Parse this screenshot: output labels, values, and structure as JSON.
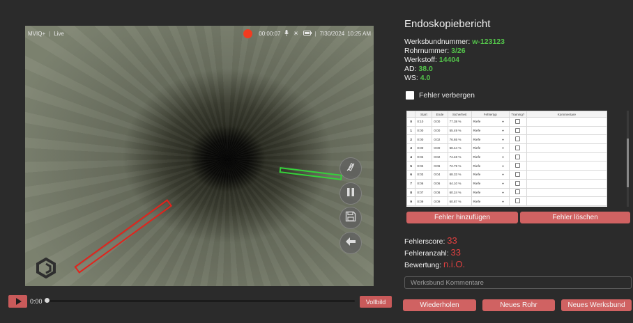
{
  "video": {
    "brand": "MVIQ+",
    "mode": "Live",
    "rec_time": "00:00:07",
    "date": "7/30/2024",
    "time": "10:25 AM",
    "side_buttons": [
      "light-off-icon",
      "pause-icon",
      "save-icon",
      "back-arrow-icon"
    ],
    "defect_colors": {
      "green": "#35d13a",
      "red": "#e2231c"
    }
  },
  "playback": {
    "time": "0:00",
    "fullscreen_label": "Vollbild",
    "play_color": "#c95a5a"
  },
  "report": {
    "title": "Endoskopiebericht",
    "fields": [
      {
        "label": "Werksbundnummer: ",
        "value": "w-123123"
      },
      {
        "label": "Rohrnummer: ",
        "value": "3/26"
      },
      {
        "label": "Werkstoff: ",
        "value": "14404"
      },
      {
        "label": "AD: ",
        "value": "38.0"
      },
      {
        "label": "WS: ",
        "value": "4.0"
      }
    ],
    "hide_errors_label": "Fehler verbergen",
    "table": {
      "columns": [
        "",
        "Start",
        "Ende",
        "Sicherheit",
        "Fehlertyp",
        "Training?",
        "Kommentare"
      ],
      "rows": [
        {
          "idx": "0",
          "start": "0:10",
          "end": "0:00",
          "conf": "77.38 %",
          "type": "Riefe"
        },
        {
          "idx": "1",
          "start": "0:00",
          "end": "0:00",
          "conf": "55.49 %",
          "type": "Riefe"
        },
        {
          "idx": "2",
          "start": "0:00",
          "end": "0:02",
          "conf": "76.65 %",
          "type": "Riefe"
        },
        {
          "idx": "3",
          "start": "0:00",
          "end": "0:00",
          "conf": "68.44 %",
          "type": "Riefe"
        },
        {
          "idx": "4",
          "start": "0:02",
          "end": "0:02",
          "conf": "74.48 %",
          "type": "Riefe"
        },
        {
          "idx": "5",
          "start": "0:02",
          "end": "0:06",
          "conf": "72.79 %",
          "type": "Riefe"
        },
        {
          "idx": "6",
          "start": "0:03",
          "end": "0:04",
          "conf": "68.33 %",
          "type": "Riefe"
        },
        {
          "idx": "7",
          "start": "0:06",
          "end": "0:06",
          "conf": "64.10 %",
          "type": "Riefe"
        },
        {
          "idx": "8",
          "start": "0:07",
          "end": "0:08",
          "conf": "60.24 %",
          "type": "Riefe"
        },
        {
          "idx": "9",
          "start": "0:09",
          "end": "0:09",
          "conf": "60.87 %",
          "type": "Riefe"
        }
      ]
    },
    "add_error_label": "Fehler hinzufügen",
    "delete_error_label": "Fehler löschen",
    "score_label": "Fehlerscore: ",
    "score_value": "33",
    "count_label": "Fehleranzahl: ",
    "count_value": "33",
    "rating_label": "Bewertung: ",
    "rating_value": "n.i.O.",
    "comment_placeholder": "Werksbund Kommentare",
    "repeat_label": "Wiederholen",
    "new_pipe_label": "Neues Rohr",
    "new_bundle_label": "Neues Werksbund",
    "accent_color": "#d06262",
    "value_green": "#53c24a",
    "value_red": "#e04040"
  }
}
